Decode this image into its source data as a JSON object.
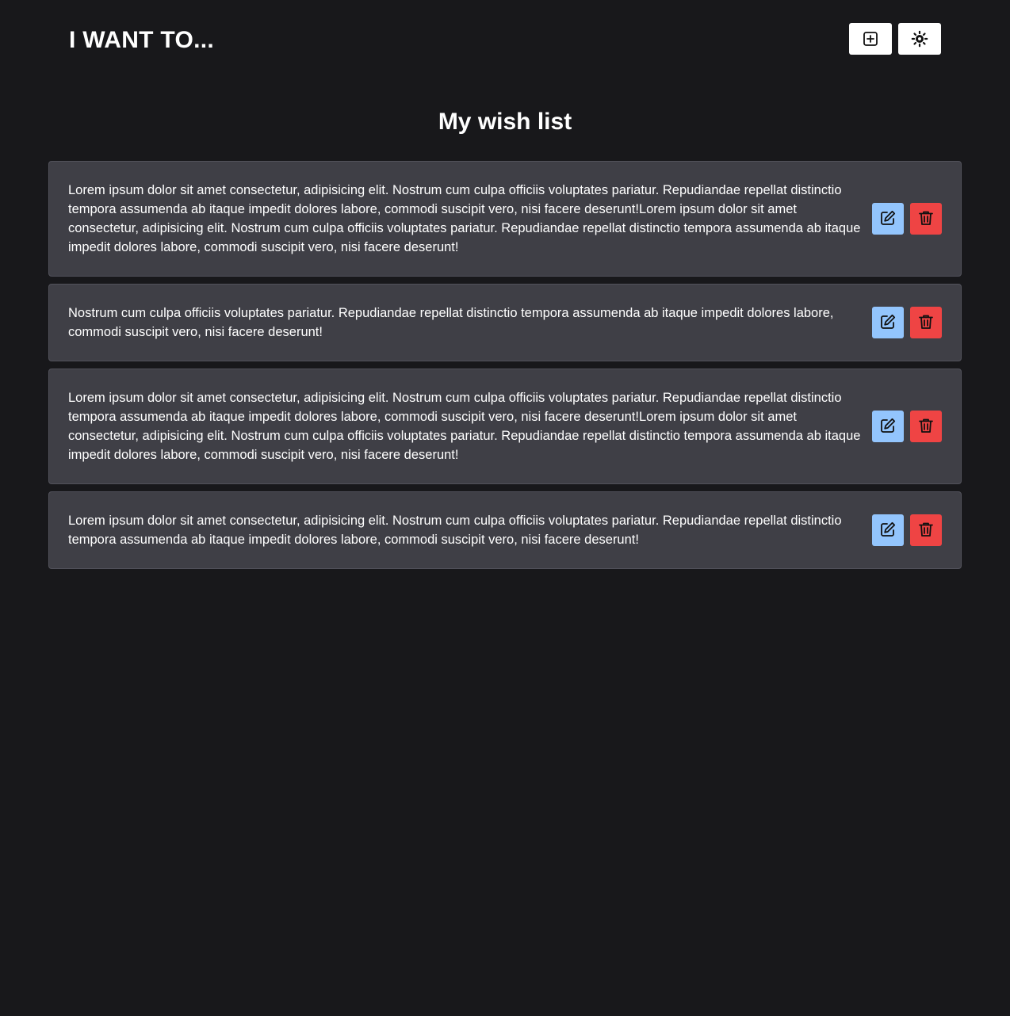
{
  "header": {
    "brand": "I WANT TO...",
    "add_icon": "plus-square-icon",
    "theme_icon": "sun-icon"
  },
  "main": {
    "title": "My wish list",
    "items": [
      {
        "text": "Lorem ipsum dolor sit amet consectetur, adipisicing elit. Nostrum cum culpa officiis voluptates pariatur. Repudiandae repellat distinctio tempora assumenda ab itaque impedit dolores labore, commodi suscipit vero, nisi facere deserunt!Lorem ipsum dolor sit amet consectetur, adipisicing elit. Nostrum cum culpa officiis voluptates pariatur. Repudiandae repellat distinctio tempora assumenda ab itaque impedit dolores labore, commodi suscipit vero, nisi facere deserunt!"
      },
      {
        "text": "Nostrum cum culpa officiis voluptates pariatur. Repudiandae repellat distinctio tempora assumenda ab itaque impedit dolores labore, commodi suscipit vero, nisi facere deserunt!"
      },
      {
        "text": "Lorem ipsum dolor sit amet consectetur, adipisicing elit. Nostrum cum culpa officiis voluptates pariatur. Repudiandae repellat distinctio tempora assumenda ab itaque impedit dolores labore, commodi suscipit vero, nisi facere deserunt!Lorem ipsum dolor sit amet consectetur, adipisicing elit. Nostrum cum culpa officiis voluptates pariatur. Repudiandae repellat distinctio tempora assumenda ab itaque impedit dolores labore, commodi suscipit vero, nisi facere deserunt!"
      },
      {
        "text": "Lorem ipsum dolor sit amet consectetur, adipisicing elit. Nostrum cum culpa officiis voluptates pariatur. Repudiandae repellat distinctio tempora assumenda ab itaque impedit dolores labore, commodi suscipit vero, nisi facere deserunt!"
      }
    ],
    "edit_icon": "pencil-square-icon",
    "delete_icon": "trash-icon"
  },
  "colors": {
    "background": "#18181b",
    "card": "#3f3f46",
    "edit_button": "#93c5fd",
    "delete_button": "#ef4444"
  }
}
